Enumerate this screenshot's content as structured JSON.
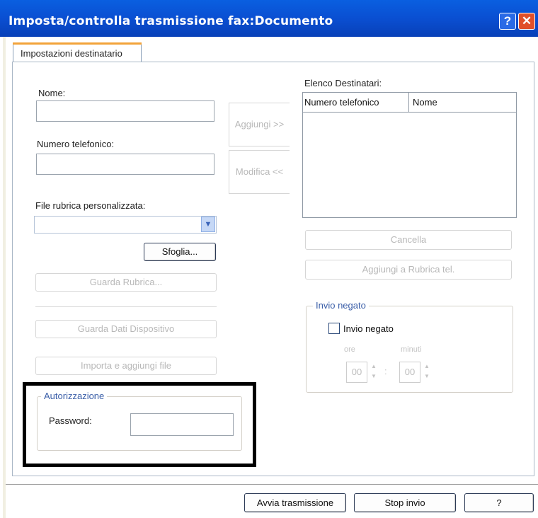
{
  "window": {
    "title": "Imposta/controlla trasmissione fax:Documento",
    "help_icon": "?",
    "close_icon": "✕"
  },
  "tabs": [
    {
      "label": "Impostazioni destinatario",
      "selected": true
    }
  ],
  "form": {
    "name_label": "Nome:",
    "name_value": "",
    "phone_label": "Numero telefonico:",
    "phone_value": "",
    "phonebook_file_label": "File rubrica personalizzata:",
    "phonebook_file_value": "",
    "browse_button": "Sfoglia...",
    "view_phonebook_button": "Guarda Rubrica...",
    "view_device_data_button": "Guarda Dati Dispositivo",
    "import_add_file_button": "Importa e aggiungi file"
  },
  "middle_buttons": {
    "add": "Aggiungi >>",
    "modify": "Modifica <<"
  },
  "recipients": {
    "label": "Elenco Destinatari:",
    "columns": [
      "Numero telefonico",
      "Nome"
    ],
    "rows": []
  },
  "list_buttons": {
    "delete": "Cancella",
    "add_to_phonebook": "Aggiungi a Rubrica tel."
  },
  "deny_send": {
    "group_label": "Invio negato",
    "checkbox_label": "Invio negato",
    "checked": false,
    "hours_label": "ore",
    "hours_value": "00",
    "minutes_label": "minuti",
    "minutes_value": "00",
    "time_separator": ":"
  },
  "authorization": {
    "group_label": "Autorizzazione",
    "password_label": "Password:",
    "password_value": ""
  },
  "footer": {
    "start_button": "Avvia trasmissione",
    "stop_button": "Stop invio",
    "help_button": "?"
  }
}
